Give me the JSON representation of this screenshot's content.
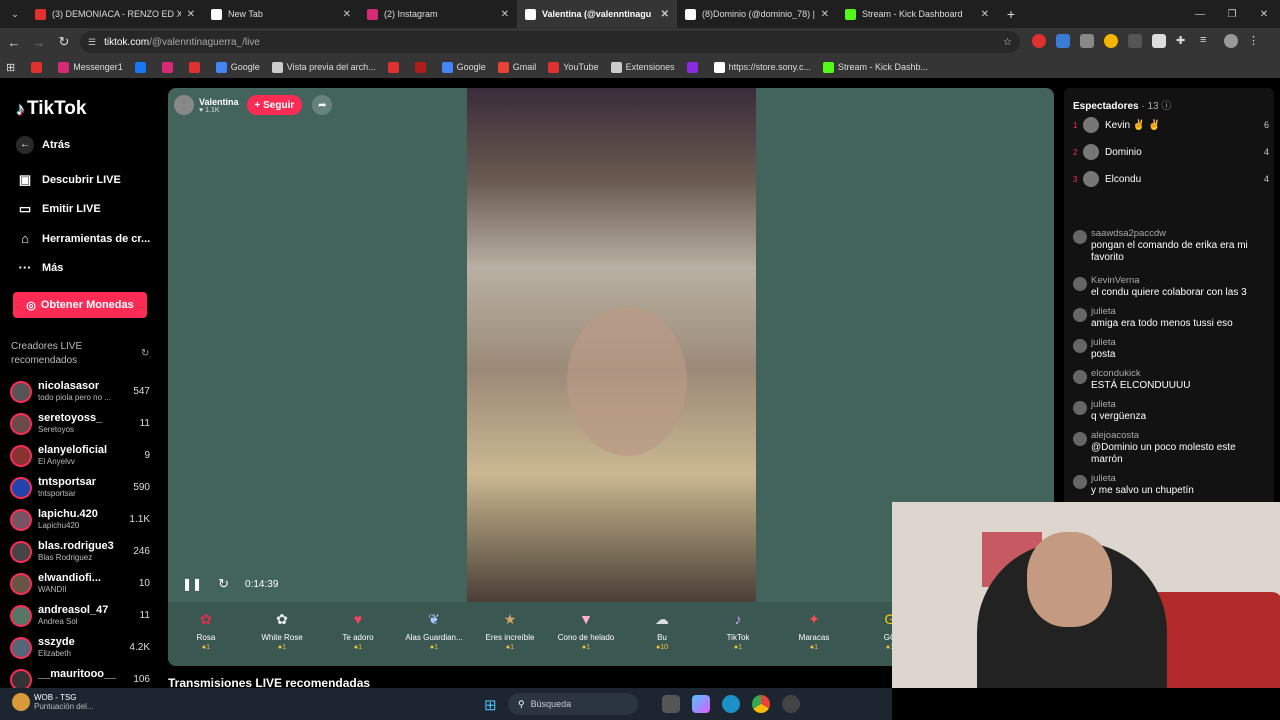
{
  "browser": {
    "tabs": [
      {
        "title": "(3) DEMONIACA - RENZO ED X",
        "color": "#e03030",
        "active": false
      },
      {
        "title": "New Tab",
        "color": "#ffffff",
        "active": false
      },
      {
        "title": "(2) Instagram",
        "color": "#d62976",
        "active": false
      },
      {
        "title": "Valentina (@valenntinagu",
        "color": "#ffffff",
        "active": true
      },
      {
        "title": "(8)Dominio (@dominio_78) | Tik",
        "color": "#ffffff",
        "active": false
      },
      {
        "title": "Stream - Kick Dashboard",
        "color": "#53fc18",
        "active": false
      }
    ],
    "url_host": "tiktok.com",
    "url_path": "/@valenntinaguerra_/live",
    "bookmarks": [
      {
        "label": "",
        "color": "#e03030"
      },
      {
        "label": "Messenger1",
        "color": "#d62976"
      },
      {
        "label": "",
        "color": "#1877f2"
      },
      {
        "label": "",
        "color": "#d62976"
      },
      {
        "label": "",
        "color": "#e03030"
      },
      {
        "label": "Google",
        "color": "#4285f4"
      },
      {
        "label": "Vista previa del arch...",
        "color": "#cccccc"
      },
      {
        "label": "",
        "color": "#e03030"
      },
      {
        "label": "",
        "color": "#b01c1c"
      },
      {
        "label": "Google",
        "color": "#4285f4"
      },
      {
        "label": "Gmail",
        "color": "#ea4335"
      },
      {
        "label": "YouTube",
        "color": "#e03030"
      },
      {
        "label": "Extensiones",
        "color": "#cccccc"
      },
      {
        "label": "",
        "color": "#8a2be2"
      },
      {
        "label": "https://store.sony.c...",
        "color": "#ffffff"
      },
      {
        "label": "Stream - Kick Dashb...",
        "color": "#53fc18"
      }
    ]
  },
  "tiktok": {
    "logo": "TikTok",
    "nav": {
      "back": "Atrás",
      "discover": "Descubrir LIVE",
      "go_live": "Emitir LIVE",
      "tools": "Herramientas de cr...",
      "more": "Más"
    },
    "coins_button": "Obtener Monedas",
    "recommended_title": "Creadores LIVE recomendados",
    "creators": [
      {
        "name": "nicolasasor",
        "sub": "todo piola pero no ...",
        "count": "547"
      },
      {
        "name": "seretoyoss_",
        "sub": "Seretoyos",
        "count": "11"
      },
      {
        "name": "elanyeloficial",
        "sub": "El Anyelvv",
        "count": "9"
      },
      {
        "name": "tntsportsar",
        "sub": "tntsportsar",
        "count": "590"
      },
      {
        "name": "lapichu.420",
        "sub": "Lapichu420",
        "count": "1.1K"
      },
      {
        "name": "blas.rodrigue3",
        "sub": "Blas Rodriguez",
        "count": "246"
      },
      {
        "name": "elwandiofi...",
        "sub": "WANDII",
        "count": "10"
      },
      {
        "name": "andreasol_47",
        "sub": "Andrea Sol",
        "count": "11"
      },
      {
        "name": "sszyde",
        "sub": "Elizabeth",
        "count": "4.2K"
      },
      {
        "name": "__mauritooo__",
        "sub": "",
        "count": "106"
      }
    ],
    "host": {
      "name": "Valentina",
      "likes": "1.1K",
      "follow": "+ Seguir"
    },
    "player": {
      "time": "0:14:39"
    },
    "gifts": [
      {
        "name": "Rosa",
        "price": "1",
        "color": "#e0304a",
        "glyph": "✿"
      },
      {
        "name": "White Rose",
        "price": "1",
        "color": "#eeeeee",
        "glyph": "✿"
      },
      {
        "name": "Te adoro",
        "price": "1",
        "color": "#ff4060",
        "glyph": "♥"
      },
      {
        "name": "Alas Guardian...",
        "price": "1",
        "color": "#a8c8ff",
        "glyph": "❦"
      },
      {
        "name": "Eres increíble",
        "price": "1",
        "color": "#d9a36a",
        "glyph": "★"
      },
      {
        "name": "Cono de helado",
        "price": "1",
        "color": "#ffb0d0",
        "glyph": "▼"
      },
      {
        "name": "Bu",
        "price": "10",
        "color": "#dddddd",
        "glyph": "☁"
      },
      {
        "name": "TikTok",
        "price": "1",
        "color": "#c0b0ff",
        "glyph": "♪"
      },
      {
        "name": "Maracas",
        "price": "1",
        "color": "#ff5050",
        "glyph": "✦"
      },
      {
        "name": "GG",
        "price": "1",
        "color": "#ffcc00",
        "glyph": "G"
      }
    ],
    "recommended_streams": "Transmisiones LIVE recomendadas",
    "viewers": {
      "title": "Espectadores",
      "count": "13",
      "top": [
        {
          "rank": "1",
          "name": "Kevin ✌ ✌",
          "score": "6"
        },
        {
          "rank": "2",
          "name": "Dominio",
          "score": "4"
        },
        {
          "rank": "3",
          "name": "Elcondu",
          "score": "4"
        }
      ]
    },
    "chat": [
      {
        "user": "saawdsa2paccdw",
        "msg": "pongan el comando de erika era mi favorito"
      },
      {
        "user": "KevinVerna",
        "msg": "el condu quiere colaborar con las 3"
      },
      {
        "user": "julieta",
        "msg": "amiga era todo menos tussi eso"
      },
      {
        "user": "julieta",
        "msg": "posta"
      },
      {
        "user": "elcondukick",
        "msg": "ESTÁ ELCONDUUUU"
      },
      {
        "user": "julieta",
        "msg": "q vergüenza"
      },
      {
        "user": "alejoacosta",
        "msg": "@Dominio un poco molesto este marrón"
      },
      {
        "user": "julieta",
        "msg": "y me salvo un chupetín"
      }
    ]
  },
  "taskbar": {
    "weather_title": "WOB - TSG",
    "weather_sub": "Puntuación del...",
    "search": "Búsqueda"
  }
}
